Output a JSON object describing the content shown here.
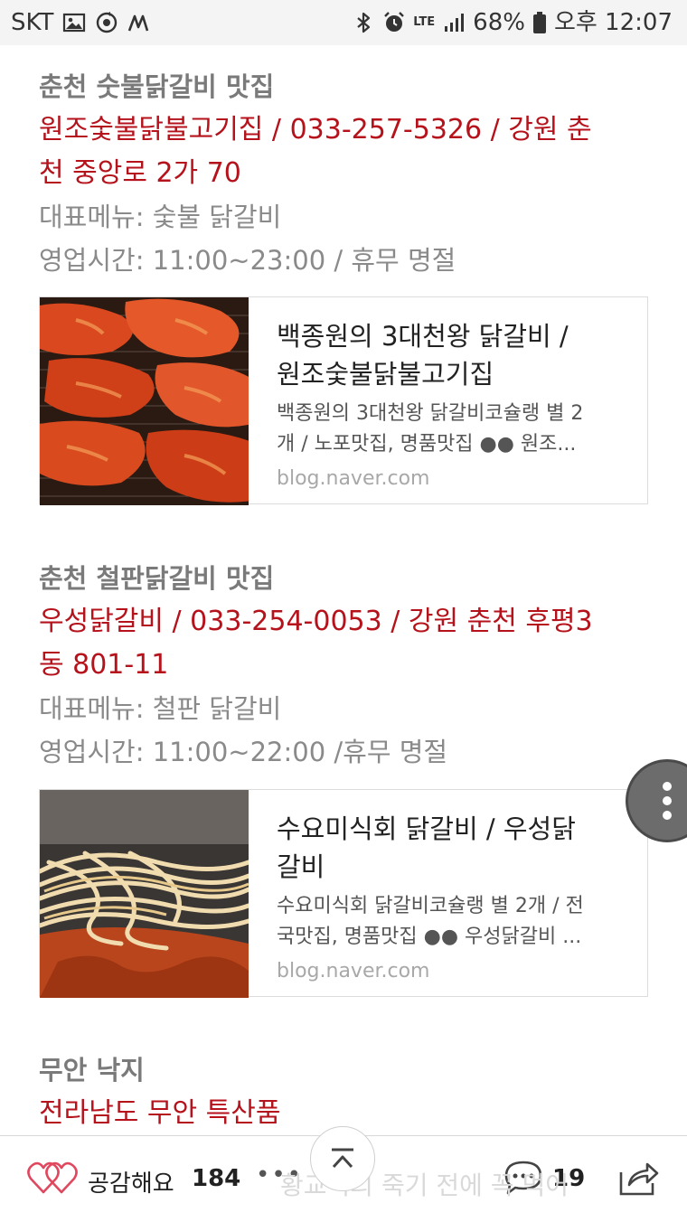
{
  "status_bar": {
    "carrier": "SKT",
    "network": "LTE",
    "battery": "68%",
    "time": "오후 12:07"
  },
  "sections": [
    {
      "title": "춘천 숫불닭갈비 맛집",
      "red_line1": "원조숯불닭불고기집 / 033-257-5326  / 강원 춘",
      "red_line2": "천 중앙로 2가 70",
      "menu": "대표메뉴: 숯불 닭갈비",
      "hours": "영업시간: 11:00~23:00 / 휴무 명절",
      "card": {
        "title_line1": "백종원의 3대천왕 닭갈비 /",
        "title_line2": "원조숯불닭불고기집",
        "desc_line1": "백종원의 3대천왕 닭갈비코슐랭 별 2",
        "desc_line2": "개 / 노포맛집, 명품맛집 ●● 원조...",
        "url": "blog.naver.com"
      }
    },
    {
      "title": "춘천 철판닭갈비 맛집",
      "red_line1": "우성닭갈비 / 033-254-0053 /  강원 춘천 후평3",
      "red_line2": "동 801-11",
      "menu": "대표메뉴: 철판 닭갈비",
      "hours": "영업시간: 11:00~22:00 /휴무 명절",
      "card": {
        "title_line1": "수요미식회 닭갈비 / 우성닭",
        "title_line2": "갈비",
        "desc_line1": "수요미식회 닭갈비코슐랭 별 2개 / 전",
        "desc_line2": "국맛집, 명품맛집 ●● 우성닭갈비 ...",
        "url": "blog.naver.com"
      }
    },
    {
      "title": "무안 낙지",
      "red_line1": "전라남도 무안 특산품"
    }
  ],
  "bottom_bar": {
    "like_label": "공감해요",
    "like_count": "184",
    "more_dots": "•••",
    "comment_count": "19",
    "ghost_text": "황교익의 죽기 전에 꼭 먹어"
  },
  "colors": {
    "accent_red": "#b5121b",
    "like_pink": "#e0485f"
  }
}
